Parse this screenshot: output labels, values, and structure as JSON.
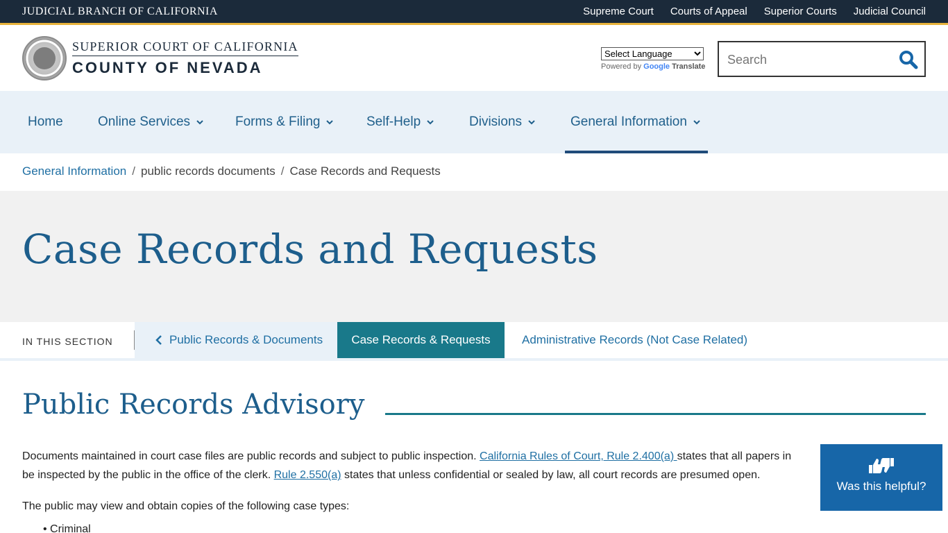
{
  "topbar": {
    "brand": "Judicial Branch of California",
    "links": [
      "Supreme Court",
      "Courts of Appeal",
      "Superior Courts",
      "Judicial Council"
    ]
  },
  "header": {
    "line1": "Superior Court of California",
    "line2": "County of Nevada",
    "translate_select": "Select Language",
    "powered_by": "Powered by",
    "google": "Google",
    "translate": "Translate",
    "search_placeholder": "Search"
  },
  "nav": {
    "items": [
      "Home",
      "Online Services",
      "Forms & Filing",
      "Self-Help",
      "Divisions",
      "General Information"
    ],
    "active": "General Information"
  },
  "breadcrumb": [
    "General Information",
    "public records documents",
    "Case Records and Requests"
  ],
  "page_title": "Case Records and Requests",
  "section": {
    "label": "In this section",
    "prev": "Public Records & Documents",
    "current": "Case Records & Requests",
    "next": "Administrative Records (Not Case Related)"
  },
  "content": {
    "heading": "Public Records Advisory",
    "p1_a": "Documents maintained in court case files are public records and subject to public inspection. ",
    "p1_link1": "California Rules of Court, Rule 2.400(a) ",
    "p1_b": "states that all papers in",
    "p1_c": "be inspected by the public in the office of the clerk. ",
    "p1_link2": "Rule 2.550(a)",
    "p1_d": " states that unless confidential or sealed by law, all court records are presumed open.",
    "p2": "The public may view and obtain copies of the following case types:",
    "list_first": "Criminal"
  },
  "feedback": {
    "label": "Was this helpful?"
  },
  "colors": {
    "topbar_bg": "#1b2a3a",
    "accent_gold": "#e8b33b",
    "nav_bg": "#e9f1f8",
    "link_blue": "#1f6fa3",
    "teal": "#19798a",
    "feedback_blue": "#1766a8"
  }
}
